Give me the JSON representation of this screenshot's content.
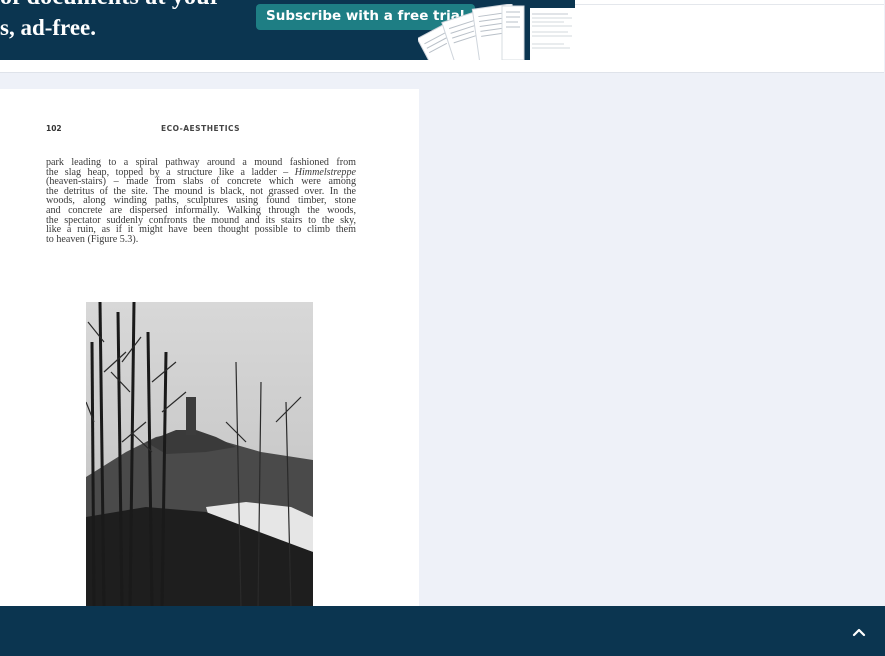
{
  "promo": {
    "headline_line1": "of documents at your",
    "headline_line2": "s, ad-free.",
    "cta_label": "Subscribe with a free trial"
  },
  "document": {
    "page_number": "102",
    "running_head": "ECO-AESTHETICS",
    "lines": [
      "park leading to a spiral pathway around a mound fashioned from",
      "the slag heap, topped by a structure like a ladder – Himmelstreppe",
      "(heaven-stairs) – made from slabs of concrete which were among",
      "the detritus of the site. The mound is black, not grassed over. In the",
      "woods, along winding paths, sculptures using found timber, stone",
      "and concrete are dispersed informally. Walking through the woods,",
      "the spectator suddenly confronts the mound and its stairs to the sky,",
      "like a ruin, as if it might have been thought possible to climb them",
      "to heaven (Figure 5.3)."
    ]
  },
  "colors": {
    "navy": "#0b3550",
    "cta_teal": "#1e7e84",
    "page_bg": "#eef1f8"
  },
  "icons": {
    "scroll_top": "chevron-up-icon"
  }
}
